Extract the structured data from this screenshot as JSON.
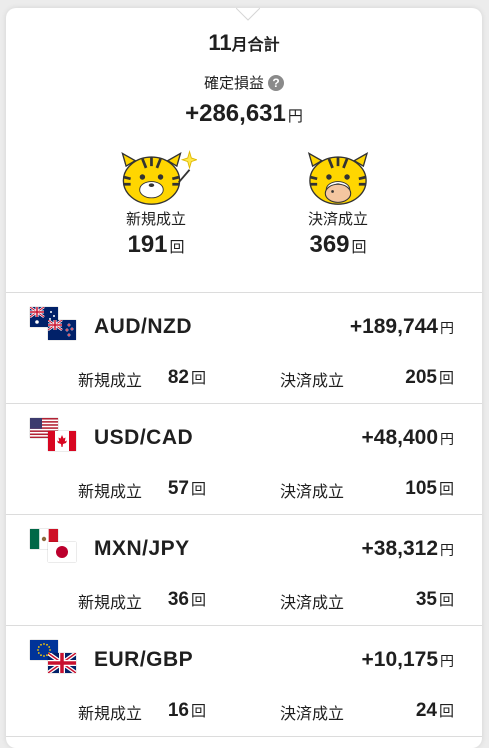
{
  "summary": {
    "month_number": "11",
    "month_suffix": "月合計",
    "pl_label": "確定損益",
    "help_icon": "?",
    "pl_value": "+286,631",
    "currency": "円",
    "new_label": "新規成立",
    "new_count": "191",
    "settle_label": "決済成立",
    "settle_count": "369",
    "count_unit": "回"
  },
  "pairs": [
    {
      "name": "AUD/NZD",
      "pl": "+189,744",
      "new_label": "新規成立",
      "new_count": "82",
      "settle_label": "決済成立",
      "settle_count": "205",
      "flags": [
        "au",
        "nz"
      ]
    },
    {
      "name": "USD/CAD",
      "pl": "+48,400",
      "new_label": "新規成立",
      "new_count": "57",
      "settle_label": "決済成立",
      "settle_count": "105",
      "flags": [
        "us",
        "ca"
      ]
    },
    {
      "name": "MXN/JPY",
      "pl": "+38,312",
      "new_label": "新規成立",
      "new_count": "36",
      "settle_label": "決済成立",
      "settle_count": "35",
      "flags": [
        "mx",
        "jp"
      ]
    },
    {
      "name": "EUR/GBP",
      "pl": "+10,175",
      "new_label": "新規成立",
      "new_count": "16",
      "settle_label": "決済成立",
      "settle_count": "24",
      "flags": [
        "eu",
        "gb"
      ]
    }
  ],
  "colors": {
    "mascot_yellow": "#FFD600",
    "text": "#1f1f1f",
    "divider": "#dcdcdc"
  }
}
